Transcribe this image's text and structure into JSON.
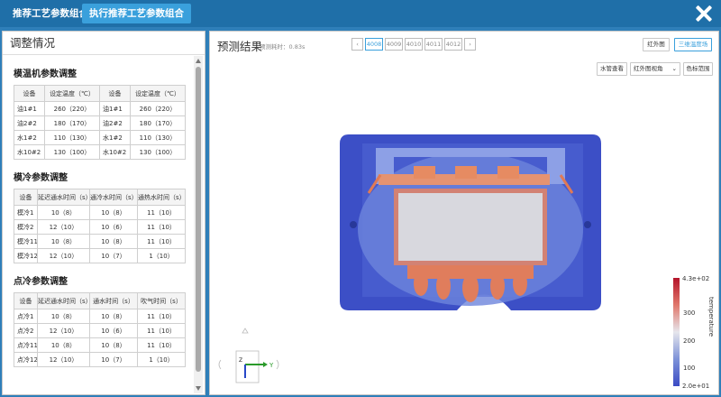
{
  "topbar": {
    "tab1_label": "推荐工艺参数组合",
    "tab2_label": "执行推荐工艺参数组合"
  },
  "left": {
    "header": "调整情况",
    "mold_temp": {
      "title": "模温机参数调整",
      "headers": [
        "设备",
        "设定温度（℃）",
        "设备",
        "设定温度（℃）"
      ],
      "rows": [
        [
          "油1#1",
          "260（220）",
          "油1#1",
          "260（220）"
        ],
        [
          "油2#2",
          "180（170）",
          "油2#2",
          "180（170）"
        ],
        [
          "水1#2",
          "110（130）",
          "水1#2",
          "110（130）"
        ],
        [
          "水10#2",
          "130（100）",
          "水10#2",
          "130（100）"
        ]
      ]
    },
    "mold_cool": {
      "title": "模冷参数调整",
      "headers": [
        "设备",
        "延迟通水时间（s）",
        "通冷水时间（s）",
        "通热水时间（s）"
      ],
      "rows": [
        [
          "模冷1",
          "10（8）",
          "10（8）",
          "11（10）"
        ],
        [
          "模冷2",
          "12（10）",
          "10（6）",
          "11（10）"
        ],
        [
          "模冷11",
          "10（8）",
          "10（8）",
          "11（10）"
        ],
        [
          "模冷12",
          "12（10）",
          "10（7）",
          "1（10）"
        ]
      ]
    },
    "spot_cool": {
      "title": "点冷参数调整",
      "headers": [
        "设备",
        "延迟通水时间（s）",
        "通水时间（s）",
        "吹气时间（s）"
      ],
      "rows": [
        [
          "点冷1",
          "10（8）",
          "10（8）",
          "11（10）"
        ],
        [
          "点冷2",
          "12（10）",
          "10（6）",
          "11（10）"
        ],
        [
          "点冷11",
          "10（8）",
          "10（8）",
          "11（10）"
        ],
        [
          "点冷12",
          "12（10）",
          "10（7）",
          "1（10）"
        ]
      ]
    }
  },
  "right": {
    "title": "预测结果",
    "elapsed": "预测耗时：0.83s",
    "steps": [
      "4008",
      "4009",
      "4010",
      "4011",
      "4012"
    ],
    "active_step": "4008",
    "btn_infrared": "红外图",
    "btn_3d_temp": "三维温度场",
    "btn_waterpipe": "水管查看",
    "view_select": "红外图视角",
    "btn_colorrange": "色标范围",
    "colorbar": {
      "max": "4.3e+02",
      "min": "2.0e+01",
      "ticks": [
        "300",
        "200",
        "100"
      ],
      "label": "temperature"
    },
    "axes": {
      "y": "Y",
      "z": "Z"
    }
  },
  "colors": {
    "topbar": "#1f6fa8",
    "accent": "#3aa0dc",
    "cold": "#3a4fc4",
    "hot": "#e8703c"
  }
}
